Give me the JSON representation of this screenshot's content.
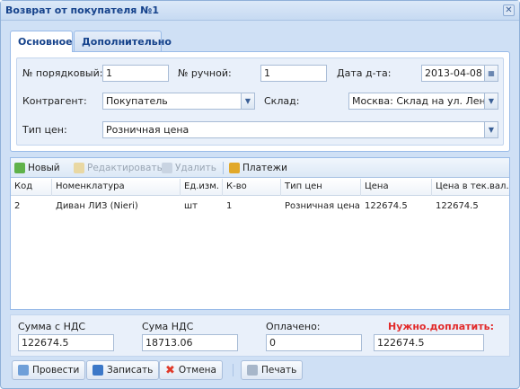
{
  "window": {
    "title": "Возврат от покупателя №1"
  },
  "tabs": [
    {
      "label": "Основное"
    },
    {
      "label": "Дополнительно"
    }
  ],
  "form": {
    "order_no_label": "№ порядковый:",
    "order_no_value": "1",
    "manual_no_label": "№ ручной:",
    "manual_no_value": "1",
    "date_label": "Дата д-та:",
    "date_value": "2013-04-08",
    "counterparty_label": "Контрагент:",
    "counterparty_value": "Покупатель",
    "warehouse_label": "Склад:",
    "warehouse_value": "Москва: Склад на ул. Ленин",
    "price_type_label": "Тип цен:",
    "price_type_value": "Розничная цена"
  },
  "toolbar": {
    "new": "Новый",
    "edit": "Редактировать",
    "delete": "Удалить",
    "payments": "Платежи"
  },
  "grid": {
    "columns": [
      "Код",
      "Номенклатура",
      "Ед.изм.",
      "К-во",
      "Тип цен",
      "Цена",
      "Цена в тек.вал."
    ],
    "rows": [
      [
        "2",
        "Диван ЛИЗ (Nieri)",
        "шт",
        "1",
        "Розничная цена",
        "122674.5",
        "122674.5"
      ]
    ]
  },
  "totals": {
    "sum_vat_label": "Сумма с НДС",
    "sum_vat_value": "122674.5",
    "vat_label": "Сума НДС",
    "vat_value": "18713.06",
    "paid_label": "Оплачено:",
    "paid_value": "0",
    "due_label": "Нужно.доплатить:",
    "due_value": "122674.5"
  },
  "buttons": {
    "post": "Провести",
    "save": "Записать",
    "cancel": "Отмена",
    "print": "Печать"
  },
  "colors": {
    "accent": "#15428b",
    "due_red": "#e22b2b",
    "window_bg": "#cfe0f5"
  }
}
